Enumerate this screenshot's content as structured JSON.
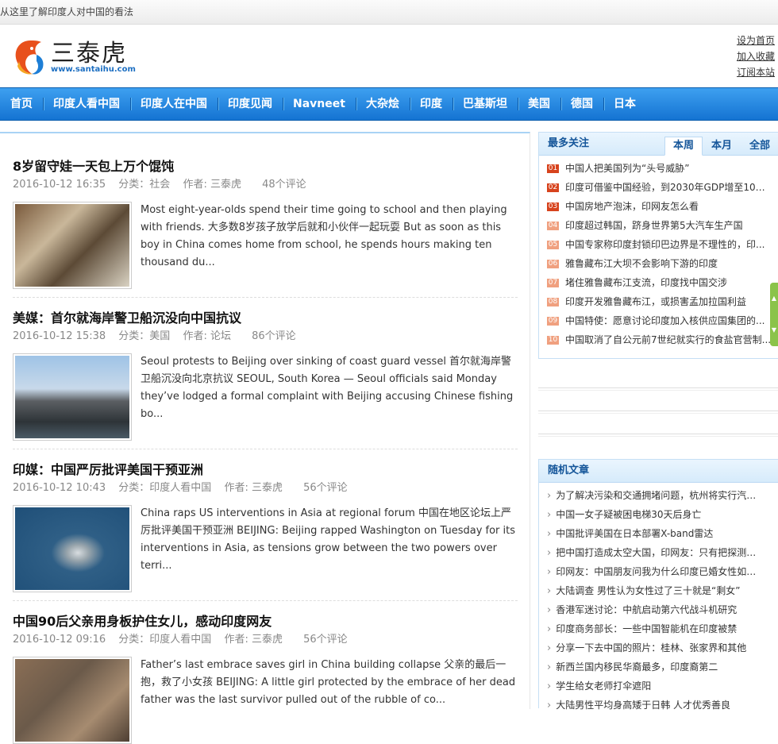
{
  "topbar": {
    "text": "从这里了解印度人对中国的看法"
  },
  "logo": {
    "cn": "三泰虎",
    "url": "www.santaihu.com"
  },
  "toplinks": [
    "设为首页",
    "加入收藏",
    "订阅本站"
  ],
  "nav": [
    "首页",
    "印度人看中国",
    "印度人在中国",
    "印度见闻",
    "Navneet",
    "大杂烩",
    "印度",
    "巴基斯坦",
    "美国",
    "德国",
    "日本"
  ],
  "articles": [
    {
      "title": "8岁留守娃一天包上万个馄饨",
      "date": "2016-10-12 16:35",
      "category": "分类：社会",
      "author": "作者: 三泰虎",
      "comments": "48个评论",
      "excerpt": "Most eight-year-olds spend their time going to school and then playing with friends. 大多数8岁孩子放学后就和小伙伴一起玩耍 But as soon as this boy in China comes home from school, he spends hours making ten thousand du..."
    },
    {
      "title": "美媒：首尔就海岸警卫船沉没向中国抗议",
      "date": "2016-10-12 15:38",
      "category": "分类：美国",
      "author": "作者: 论坛",
      "comments": "86个评论",
      "excerpt": "Seoul protests to Beijing over sinking of coast guard vessel 首尔就海岸警卫船沉没向北京抗议 SEOUL, South Korea — Seoul officials said Monday they’ve lodged a formal complaint with Beijing accusing Chinese fishing bo..."
    },
    {
      "title": "印媒：中国严厉批评美国干预亚洲",
      "date": "2016-10-12 10:43",
      "category": "分类：印度人看中国",
      "author": "作者: 三泰虎",
      "comments": "56个评论",
      "excerpt": "China raps US interventions in Asia at regional forum 中国在地区论坛上严厉批评美国干预亚洲 BEIJING: Beijing rapped Washington on Tuesday for its interventions in Asia, as tensions grow between the two powers over terri..."
    },
    {
      "title": "中国90后父亲用身板护住女儿，感动印度网友",
      "date": "2016-10-12 09:16",
      "category": "分类：印度人看中国",
      "author": "作者: 三泰虎",
      "comments": "56个评论",
      "excerpt": "Father’s last embrace saves girl in China building collapse 父亲的最后一抱，救了小女孩 BEIJING: A little girl protected by the embrace of her dead father was the last survivor pulled out of the rubble of co..."
    }
  ],
  "popular": {
    "title": "最多关注",
    "tabs": [
      "本周",
      "本月",
      "全部"
    ],
    "items": [
      {
        "num": "01",
        "text": "中国人把美国列为“头号威胁”"
      },
      {
        "num": "02",
        "text": "印度可借鉴中国经验，到2030年GDP增至10万..."
      },
      {
        "num": "03",
        "text": "中国房地产泡沫，印网友怎么看"
      },
      {
        "num": "04",
        "text": "印度超过韩国，跻身世界第5大汽车生产国"
      },
      {
        "num": "05",
        "text": "中国专家称印度封锁印巴边界是不理性的，印..."
      },
      {
        "num": "06",
        "text": "雅鲁藏布江大坝不会影响下游的印度"
      },
      {
        "num": "07",
        "text": "堵住雅鲁藏布江支流，印度找中国交涉"
      },
      {
        "num": "08",
        "text": "印度开发雅鲁藏布江，或损害孟加拉国利益"
      },
      {
        "num": "09",
        "text": "中国特使：愿意讨论印度加入核供应国集团的..."
      },
      {
        "num": "10",
        "text": "中国取消了自公元前7世纪就实行的食盐官营制..."
      }
    ]
  },
  "random": {
    "title": "随机文章",
    "items": [
      "为了解决污染和交通拥堵问题，杭州将实行汽车...",
      "中国一女子疑被困电梯30天后身亡",
      "中国批评美国在日本部署X-band雷达",
      "把中国打造成太空大国，印网友：只有把探测器...",
      "印网友：中国朋友问我为什么印度已婚女性如此...",
      "大陆调查 男性认为女性过了三十就是“剩女”",
      "香港军迷讨论：中航启动第六代战斗机研究",
      "印度商务部长：一些中国智能机在印度被禁",
      "分享一下去中国的照片：桂林、张家界和其他",
      "新西兰国内移民华裔最多，印度裔第二",
      "学生给女老师打伞遮阳",
      "大陆男性平均身高矮于日韩 人才优秀善良"
    ]
  },
  "colors": {
    "nav": "#1a7ad8",
    "accent": "#15569a",
    "rank_hot": "#d7431d",
    "rank_cold": "#f0a07f"
  }
}
